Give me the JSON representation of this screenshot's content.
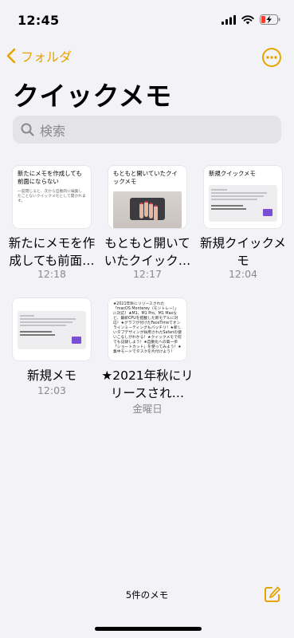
{
  "status": {
    "time": "12:45"
  },
  "nav": {
    "back_label": "フォルダ"
  },
  "title": "クイックメモ",
  "search": {
    "placeholder": "検索"
  },
  "notes": [
    {
      "thumb_title": "新たにメモを作成しても前面にならない",
      "thumb_body": "一度閉じると、次から自動的に編集したことないクイックメモとして開かれます。",
      "title": "新たにメモを作成しても前面…",
      "date": "12:18"
    },
    {
      "thumb_title": "もともと開いていたクイックメモ",
      "title": "もともと開いていたクイック…",
      "date": "12:17"
    },
    {
      "thumb_title": "新規クイックメモ",
      "title": "新規クイックメモ",
      "date": "12:04"
    },
    {
      "title": "新規メモ",
      "date": "12:03"
    },
    {
      "thumb_body": "★2021年秋にリリースされた「macOS Monterey（モントレー）」に対応！★M1、M1 Pro、M1 Maxなど、最新CPUを搭載した新モデルに対応！★グラフが付けたFaceTimeでオンラインミーティングもバッチリ！★新しいタブデザインが採用されたSafariの使いこなしがわかる！★クイックメモで何でも記録しよう！★自動化への第一歩「ショートカット」を使ってみよう！★集中モードでタスクを片付けよう！",
      "title": "★2021年秋にリリースされ…",
      "date": "金曜日"
    }
  ],
  "footer": {
    "count": "5件のメモ"
  },
  "accent": "#e6a400"
}
